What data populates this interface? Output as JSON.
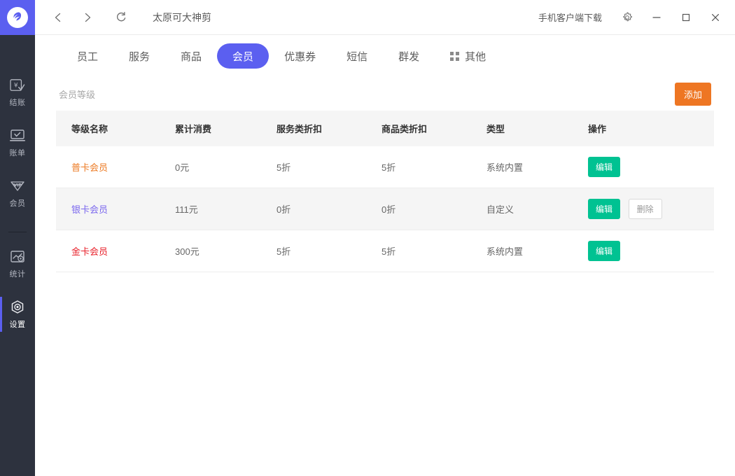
{
  "app": {
    "logo_icon": "lightning-logo-icon",
    "accent_purple": "#5b5ff0",
    "sidebar_bg": "#2d323e"
  },
  "titlebar": {
    "back_icon": "chevron-left-icon",
    "forward_icon": "chevron-right-icon",
    "refresh_icon": "refresh-icon",
    "window_title": "太原可大神剪",
    "mobile_download": "手机客户端下载",
    "settings_icon": "gear-icon",
    "minimize_icon": "minimize-icon",
    "maximize_icon": "maximize-icon",
    "close_icon": "close-icon"
  },
  "sidebar": {
    "items": [
      {
        "label": "结账",
        "icon": "checkout-icon",
        "active": false
      },
      {
        "label": "账单",
        "icon": "bill-icon",
        "active": false
      },
      {
        "label": "会员",
        "icon": "vip-member-icon",
        "active": false
      },
      {
        "label": "统计",
        "icon": "statistics-icon",
        "active": false
      },
      {
        "label": "设置",
        "icon": "settings-gear-icon",
        "active": true
      }
    ]
  },
  "tabs": [
    {
      "label": "员工",
      "active": false,
      "icon": null
    },
    {
      "label": "服务",
      "active": false,
      "icon": null
    },
    {
      "label": "商品",
      "active": false,
      "icon": null
    },
    {
      "label": "会员",
      "active": true,
      "icon": null
    },
    {
      "label": "优惠券",
      "active": false,
      "icon": null
    },
    {
      "label": "短信",
      "active": false,
      "icon": null
    },
    {
      "label": "群发",
      "active": false,
      "icon": null
    },
    {
      "label": "其他",
      "active": false,
      "icon": "grid-icon"
    }
  ],
  "card": {
    "title": "会员等级",
    "add_button": "添加"
  },
  "table": {
    "columns": [
      "等级名称",
      "累计消费",
      "服务类折扣",
      "商品类折扣",
      "类型",
      "操作"
    ],
    "rows": [
      {
        "name": "普卡会员",
        "name_color": "#ec7a23",
        "spend": "0元",
        "service_discount": "5折",
        "goods_discount": "5折",
        "type": "系统内置",
        "edit_label": "编辑",
        "delete_label": null
      },
      {
        "name": "银卡会员",
        "name_color": "#7b68ee",
        "spend": "111元",
        "service_discount": "0折",
        "goods_discount": "0折",
        "type": "自定义",
        "edit_label": "编辑",
        "delete_label": "删除"
      },
      {
        "name": "金卡会员",
        "name_color": "#e8202a",
        "spend": "300元",
        "service_discount": "5折",
        "goods_discount": "5折",
        "type": "系统内置",
        "edit_label": "编辑",
        "delete_label": null
      }
    ]
  }
}
